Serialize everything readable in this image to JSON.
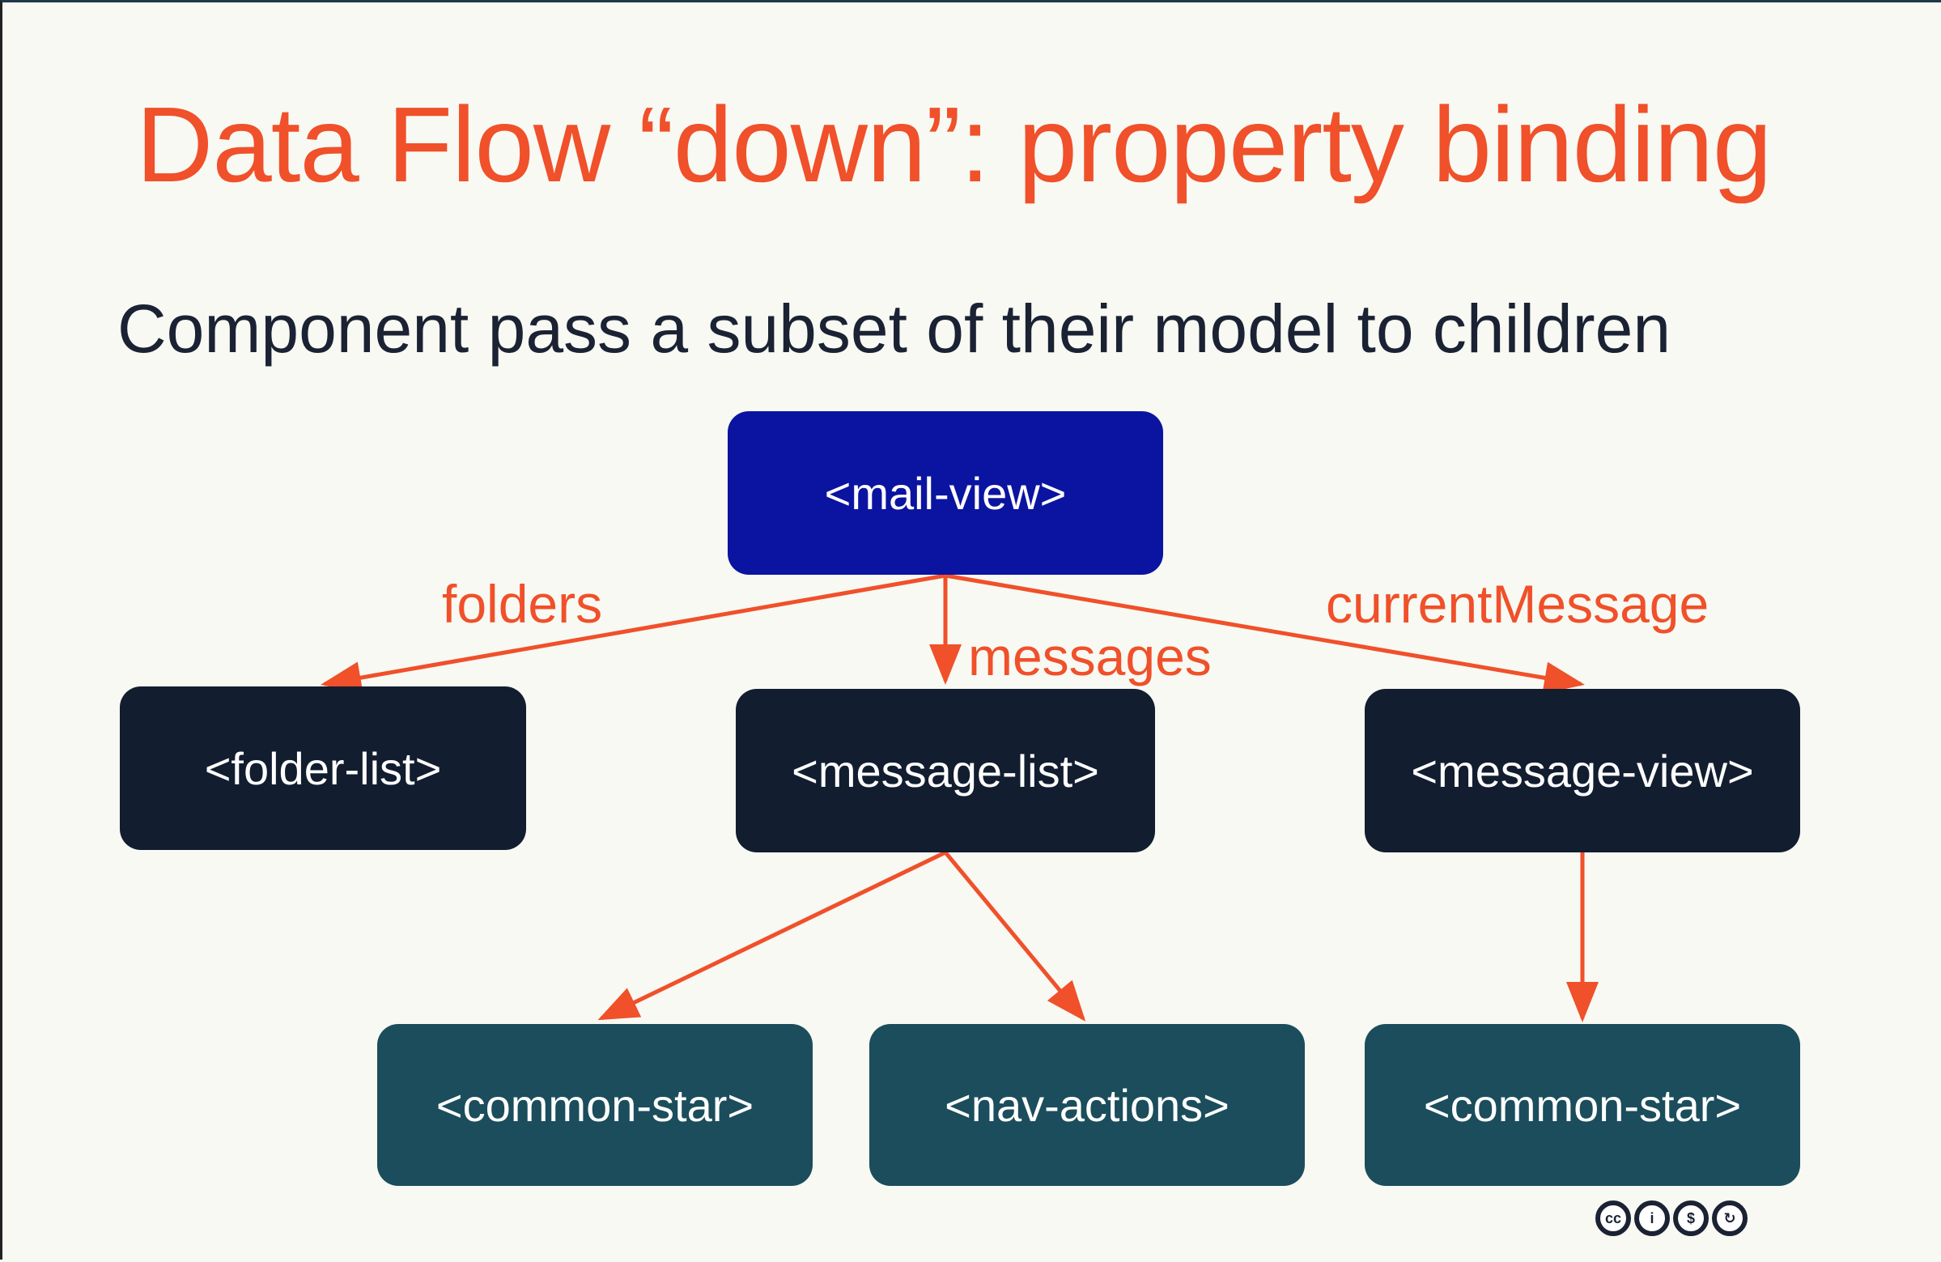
{
  "title": "Data Flow “down”: property binding",
  "subtitle": "Component pass a subset of their model to children",
  "nodes": {
    "mail_view": "<mail-view>",
    "folder_list": "<folder-list>",
    "message_list": "<message-list>",
    "message_view": "<message-view>",
    "common_star_1": "<common-star>",
    "nav_actions": "<nav-actions>",
    "common_star_2": "<common-star>"
  },
  "edge_labels": {
    "folders": "folders",
    "messages": "messages",
    "current_message": "currentMessage"
  },
  "license_icons": [
    "cc-icon",
    "attribution-icon",
    "noncommercial-icon",
    "share-alike-icon"
  ],
  "colors": {
    "accent": "#f0502a",
    "root_node": "#0b14a0",
    "mid_node": "#121d30",
    "leaf_node": "#1b4d5c",
    "background": "#f7f9f2"
  }
}
